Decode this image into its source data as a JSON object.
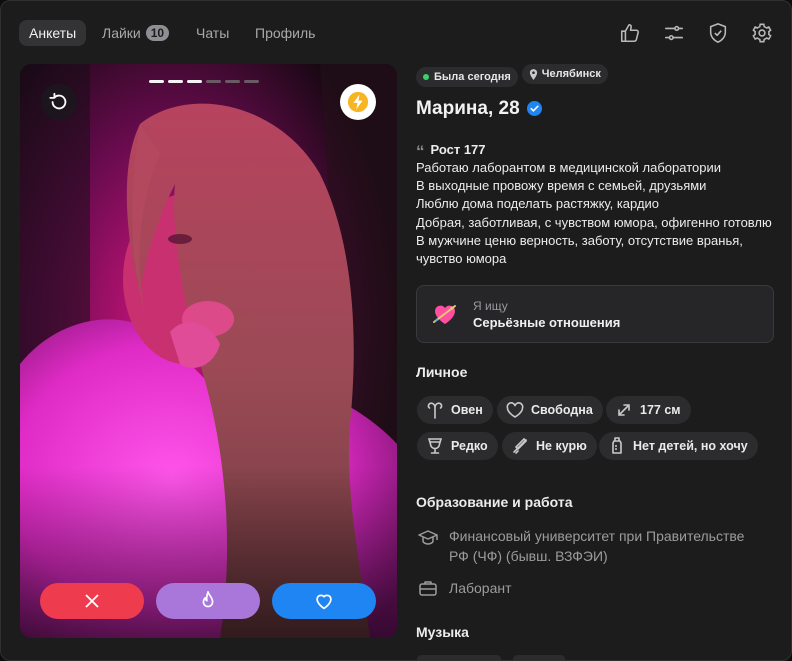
{
  "nav": {
    "tabs": [
      {
        "label": "Анкеты",
        "active": true
      },
      {
        "label": "Лайки",
        "count": "10"
      },
      {
        "label": "Чаты"
      },
      {
        "label": "Профиль"
      }
    ],
    "icons": [
      "thumbs-up-icon",
      "sliders-icon",
      "shield-check-icon",
      "gear-icon"
    ]
  },
  "photo": {
    "pages_total": 6,
    "page_current": 3,
    "undo_icon": "undo-icon",
    "boost_icon": "lightning-icon",
    "actions": [
      "close-icon",
      "flame-icon",
      "heart-icon"
    ]
  },
  "profile": {
    "status": "Была сегодня",
    "city": "Челябинск",
    "name": "Марина, 28",
    "verified": true,
    "bio": [
      "Рост 177",
      "Работаю лаборантом в медицинской лаборатории",
      "В выходные провожу время с семьей, друзьями",
      "Люблю дома поделать растяжку, кардио",
      "Добрая, заботливая, с чувством юмора, офигенно готовлю",
      "В мужчине ценю верность, заботу, отсутствие вранья,",
      "чувство юмора"
    ],
    "seeking": {
      "label": "Я ищу",
      "value": "Серьёзные отношения"
    }
  },
  "personal": {
    "title": "Личное",
    "chips": [
      {
        "icon": "aries-icon",
        "label": "Овен"
      },
      {
        "icon": "heart-outline-icon",
        "label": "Свободна"
      },
      {
        "icon": "height-icon",
        "label": "177 см"
      },
      {
        "icon": "wine-glass-icon",
        "label": "Редко"
      },
      {
        "icon": "no-smoking-icon",
        "label": "Не курю"
      },
      {
        "icon": "baby-bottle-icon",
        "label": "Нет детей, но хочу"
      }
    ]
  },
  "education": {
    "title": "Образование и работа",
    "university_line1": "Финансовый университет при Правительстве",
    "university_line2": "РФ (ЧФ) (бывш. ВЗФЭИ)",
    "job": "Лаборант"
  },
  "music": {
    "title": "Музыка"
  },
  "colors": {
    "background": "#1c1c1d",
    "chip": "#2c2c2e",
    "dislike": "#ef3b4e",
    "superlike": "#a977d9",
    "like": "#1f85f2",
    "verified": "#1f85f2",
    "online": "#3ad16c"
  }
}
